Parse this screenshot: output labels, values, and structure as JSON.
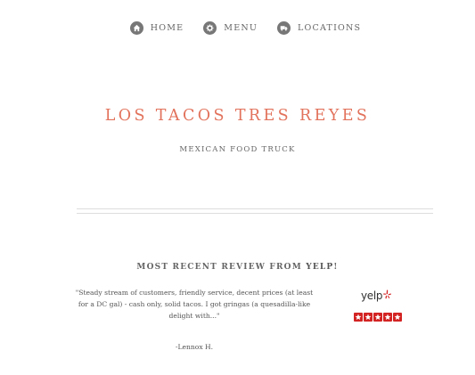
{
  "nav": {
    "items": [
      {
        "label": "HOME",
        "icon": "home-icon"
      },
      {
        "label": "MENU",
        "icon": "gear-icon"
      },
      {
        "label": "LOCATIONS",
        "icon": "truck-icon"
      }
    ]
  },
  "header": {
    "title": "LOS TACOS TRES REYES",
    "subtitle": "MEXICAN FOOD TRUCK"
  },
  "review": {
    "heading_prefix": "MOST RECENT REVIEW FROM ",
    "heading_brand": "YELP",
    "heading_suffix": "!",
    "quote": "\"Steady stream of customers, friendly service, decent prices (at least for a DC gal) - cash only, solid tacos. I got gringas (a quesadilla-like delight with...\"",
    "author": "-Lennox H.",
    "logo_text": "yelp",
    "rating": 5
  },
  "colors": {
    "accent": "#e2725b",
    "yelp_red": "#d32323",
    "text": "#555555",
    "icon_bg": "#777777"
  }
}
